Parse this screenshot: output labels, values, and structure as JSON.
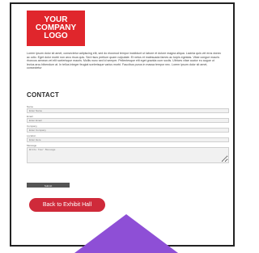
{
  "logo": {
    "line1": "YOUR",
    "line2": "COMPANY",
    "line3": "LOGO",
    "color": "#e0262c"
  },
  "intro_text": "Lorem ipsum dolor sit amet, consectetur adipiscing elit, sed do eiusmod tempor incididunt ut labore et dolore magna aliqua. Lacinia quis vel eros donec ac odio. Eget dolor morbi non arcu risus quis. Sed risus pretium quam vulputate. Et netus et malesuada fames ac turpis egestas. Vitae congue mauris rhoncus aenean vel elit scelerisque mauris. Mollis nunc sed id semper. Pellentesque elit eget gravida cum sociis. Ultrices vitae auctor eu augue ut lectus arcu bibendum at. In tellus integer feugiat scelerisque varius morbi. Faucibus purus in massa tempor nec. Lorem ipsum dolor sit amet, consectetur",
  "contact": {
    "heading": "CONTACT",
    "fields": {
      "name": {
        "label": "Name",
        "placeholder": "Enter Name"
      },
      "email": {
        "label": "Email",
        "placeholder": "Enter Email"
      },
      "company": {
        "label": "Company",
        "placeholder": "Enter Company"
      },
      "location": {
        "label": "Location",
        "placeholder": "Enter Here"
      },
      "message": {
        "label": "Message",
        "placeholder": "Write Your Message"
      }
    },
    "submit_label": "Submit"
  },
  "back_button": {
    "label": "Back to Exhibit Hall",
    "color": "#cf2a3a"
  },
  "pointer_color": "#8e4fd6"
}
